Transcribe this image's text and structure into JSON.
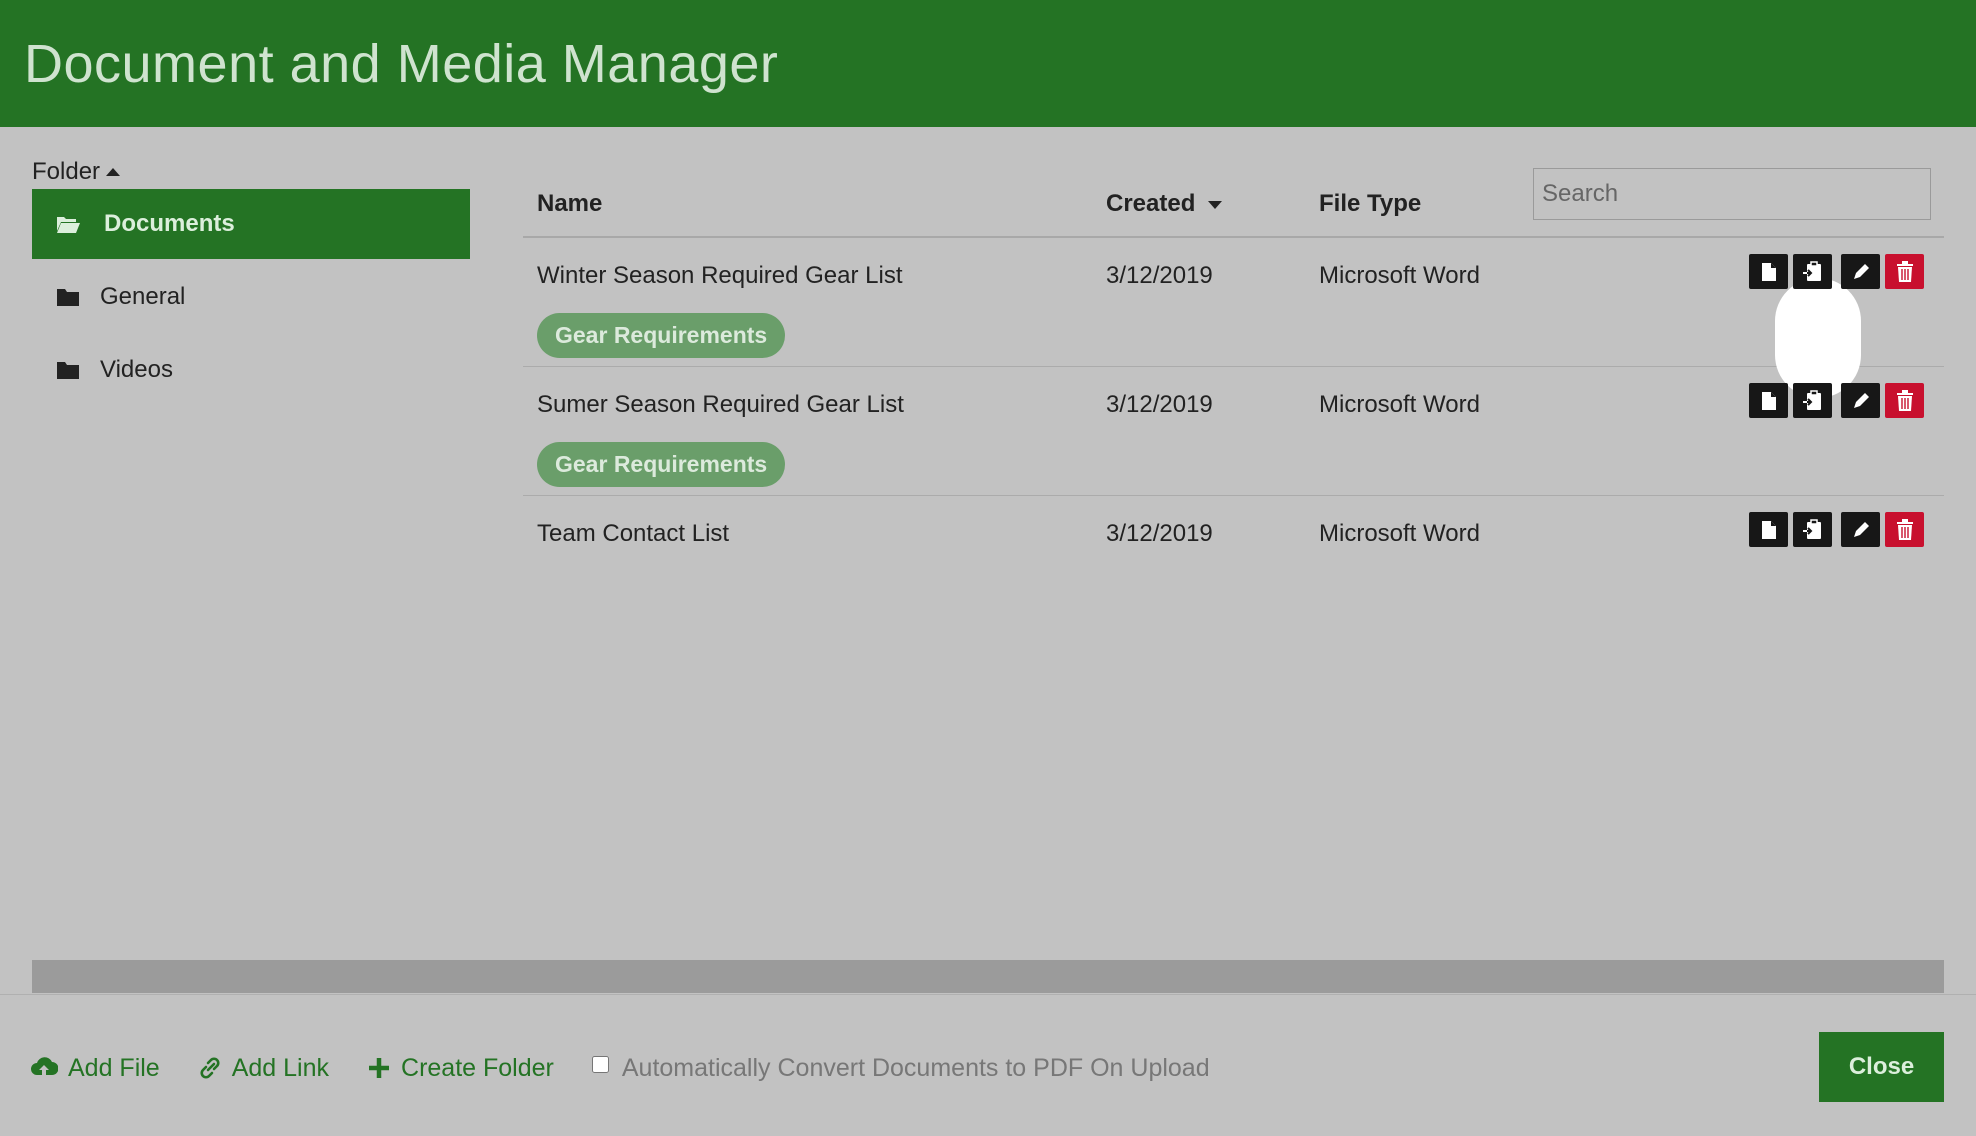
{
  "header": {
    "title": "Document and Media Manager"
  },
  "sidebar": {
    "heading": "Folder",
    "folders": [
      {
        "label": "Documents",
        "icon": "folder-open-icon",
        "active": true
      },
      {
        "label": "General",
        "icon": "folder-icon",
        "active": false
      },
      {
        "label": "Videos",
        "icon": "folder-icon",
        "active": false
      }
    ]
  },
  "table": {
    "columns": {
      "name": "Name",
      "created": "Created",
      "file_type": "File Type"
    },
    "search_placeholder": "Search",
    "rows": [
      {
        "name": "Winter Season Required Gear List",
        "created": "3/12/2019",
        "file_type": "Microsoft Word",
        "tag": "Gear Requirements"
      },
      {
        "name": "Sumer Season Required Gear List",
        "created": "3/12/2019",
        "file_type": "Microsoft Word",
        "tag": "Gear Requirements"
      },
      {
        "name": "Team Contact List",
        "created": "3/12/2019",
        "file_type": "Microsoft Word",
        "tag": ""
      }
    ],
    "actions": [
      "file-icon",
      "clipboard-icon",
      "pencil-icon",
      "trash-icon"
    ]
  },
  "footer": {
    "add_file": "Add File",
    "add_link": "Add Link",
    "create_folder": "Create Folder",
    "convert_label": "Automatically Convert Documents to PDF On Upload",
    "convert_checked": false,
    "close": "Close"
  },
  "colors": {
    "header_bg": "#247324",
    "page_bg": "#c2c2c2",
    "tag_bg": "#6a9e6a",
    "delete_red": "#c8102e",
    "action_black": "#171717"
  }
}
